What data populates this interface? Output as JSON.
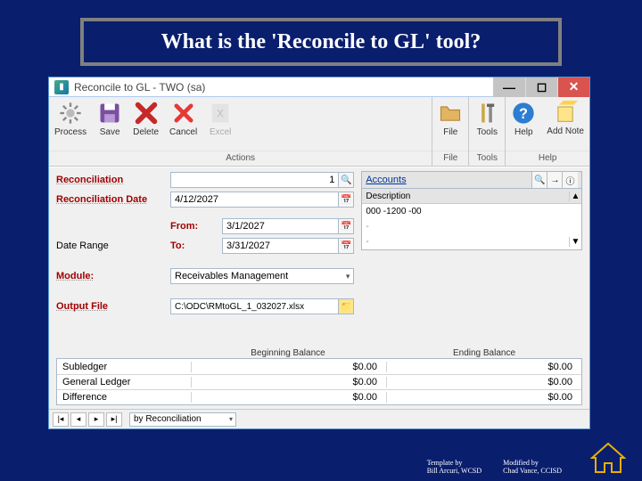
{
  "slide": {
    "title": "What is the 'Reconcile to GL' tool?"
  },
  "window": {
    "title": "Reconcile to GL  -  TWO (sa)"
  },
  "ribbon": {
    "actions_group": "Actions",
    "file_group": "File",
    "tools_group": "Tools",
    "help_group": "Help",
    "process": "Process",
    "save": "Save",
    "delete": "Delete",
    "cancel": "Cancel",
    "excel": "Excel",
    "file": "File",
    "tools": "Tools",
    "help": "Help",
    "add_note": "Add Note"
  },
  "form": {
    "reconciliation_label": "Reconciliation",
    "reconciliation_value": "1",
    "recon_date_label": "Reconciliation Date",
    "recon_date_value": "4/12/2027",
    "daterange_label": "Date Range",
    "from_label": "From:",
    "to_label": "To:",
    "from_value": "3/1/2027",
    "to_value": "3/31/2027",
    "module_label": "Module:",
    "module_value": "Receivables Management",
    "output_label": "Output File",
    "output_value": "C:\\ODC\\RMtoGL_1_032027.xlsx"
  },
  "accounts": {
    "link": "Accounts",
    "header": "Description",
    "row1": "000 -1200 -00",
    "row2": "-",
    "row3": "-"
  },
  "balances": {
    "col_begin": "Beginning Balance",
    "col_end": "Ending Balance",
    "subledger_label": "Subledger",
    "gl_label": "General Ledger",
    "diff_label": "Difference",
    "subledger_begin": "$0.00",
    "subledger_end": "$0.00",
    "gl_begin": "$0.00",
    "gl_end": "$0.00",
    "diff_begin": "$0.00",
    "diff_end": "$0.00"
  },
  "footer": {
    "sort": "by Reconciliation"
  },
  "credits": {
    "left1": "Template by",
    "left2": "Bill Arcuri, WCSD",
    "right1": "Modified by",
    "right2": "Chad Vance, CCISD"
  }
}
